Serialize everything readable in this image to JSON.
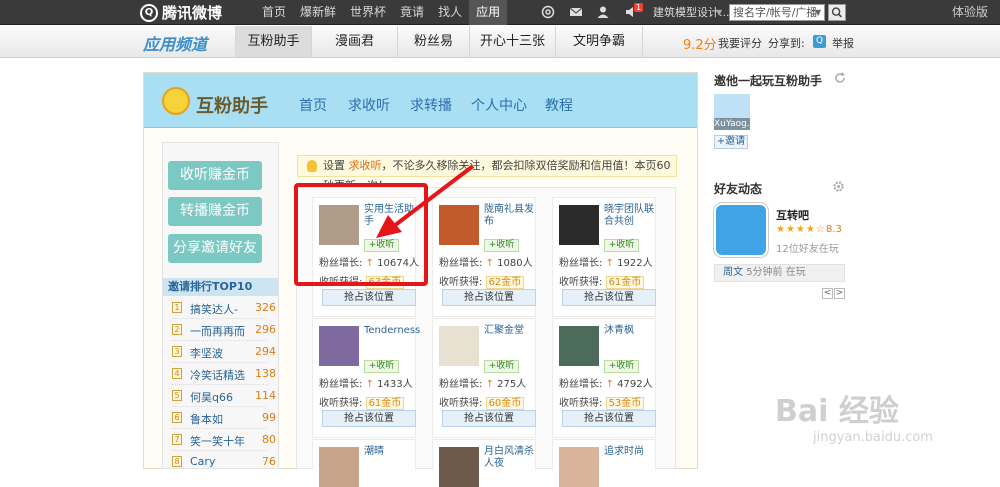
{
  "topbar": {
    "logo": "腾讯微博",
    "nav": [
      "首页",
      "爆新鲜",
      "世界杯",
      "竟请",
      "找人",
      "应用"
    ],
    "active_nav": "应用",
    "notify_count": "1",
    "user": "建筑模型设计...",
    "search_value": "搜名字/帐号/广播",
    "right_link": "体验版"
  },
  "channel": {
    "logo": "应用频道",
    "tabs": [
      "互粉助手",
      "漫画君",
      "粉丝易",
      "开心十三张",
      "文明争霸"
    ],
    "score": "9.2分",
    "rate": "我要评分",
    "share": "分享到:",
    "report": "举报"
  },
  "app": {
    "title": "互粉助手",
    "nav": [
      "首页",
      "求收听",
      "求转播",
      "个人中心",
      "教程"
    ]
  },
  "sidebar": {
    "buttons": [
      "收听赚金币",
      "转播赚金币",
      "分享邀请好友"
    ],
    "rank_title": "邀请排行TOP10",
    "rank": [
      {
        "no": "1",
        "name": "搞笑达人-",
        "score": "326"
      },
      {
        "no": "2",
        "name": "一而再再而",
        "score": "296"
      },
      {
        "no": "3",
        "name": "李坚波",
        "score": "294"
      },
      {
        "no": "4",
        "name": "冷笑话精选",
        "score": "138"
      },
      {
        "no": "5",
        "name": "何昊q66",
        "score": "114"
      },
      {
        "no": "6",
        "name": "鲁本如",
        "score": "99"
      },
      {
        "no": "7",
        "name": "笑一笑十年",
        "score": "80"
      },
      {
        "no": "8",
        "name": "Cary",
        "score": "76"
      }
    ]
  },
  "notice": {
    "pre": "设置 ",
    "highlight": "求收听",
    "post": "，不论多久移除关注，都会扣除双倍奖励和信用值！本页60秒更新一次！"
  },
  "cards": [
    {
      "name": "实用生活助手",
      "follow": "+收听",
      "fans_label": "粉丝增长:",
      "fans": "10674人",
      "gain_label": "收听获得:",
      "coins": "63金币",
      "occupy": "抢占该位置"
    },
    {
      "name": "陇南礼县发布",
      "follow": "+收听",
      "fans_label": "粉丝增长:",
      "fans": "1080人",
      "gain_label": "收听获得:",
      "coins": "62金币",
      "occupy": "抢占该位置"
    },
    {
      "name": "晓宇团队联合共创",
      "follow": "+收听",
      "fans_label": "粉丝增长:",
      "fans": "1922人",
      "gain_label": "收听获得:",
      "coins": "61金币",
      "occupy": "抢占该位置"
    },
    {
      "name": "Tenderness",
      "follow": "+收听",
      "fans_label": "粉丝增长:",
      "fans": "1433人",
      "gain_label": "收听获得:",
      "coins": "61金币",
      "occupy": "抢占该位置"
    },
    {
      "name": "汇聚金堂",
      "follow": "+收听",
      "fans_label": "粉丝增长:",
      "fans": "275人",
      "gain_label": "收听获得:",
      "coins": "60金币",
      "occupy": "抢占该位置"
    },
    {
      "name": "沐青枫",
      "follow": "+收听",
      "fans_label": "粉丝增长:",
      "fans": "4792人",
      "gain_label": "收听获得:",
      "coins": "53金币",
      "occupy": "抢占该位置"
    },
    {
      "name": "潮晴",
      "follow": "",
      "fans_label": "",
      "fans": "",
      "gain_label": "",
      "coins": "",
      "occupy": ""
    },
    {
      "name": "月白风清杀人夜",
      "follow": "",
      "fans_label": "",
      "fans": "",
      "gain_label": "",
      "coins": "",
      "occupy": ""
    },
    {
      "name": "追求时尚",
      "follow": "",
      "fans_label": "",
      "fans": "",
      "gain_label": "",
      "coins": "",
      "occupy": ""
    }
  ],
  "right": {
    "invite_title": "邀他一起玩互粉助手",
    "friend_name": "XuYaog...",
    "invite_btn": "+邀请",
    "friends_title": "好友动态",
    "app_name": "互转吧",
    "app_stars": "★★★★☆",
    "app_score": "8.3",
    "app_playing": "12位好友在玩",
    "week_user": "周文",
    "week_text": "5分钟前 在玩",
    "pager_prev": "<",
    "pager_next": ">"
  },
  "watermark": {
    "brand": "Bai 经验",
    "url": "jingyan.baidu.com"
  },
  "colors": {
    "topbar": "#3a3a3a",
    "accent_blue": "#2a6496",
    "header_blue": "#a9dff3",
    "green_btn": "#7cc9c3",
    "highlight_red": "#e5161a",
    "coin_orange": "#d48b12"
  }
}
